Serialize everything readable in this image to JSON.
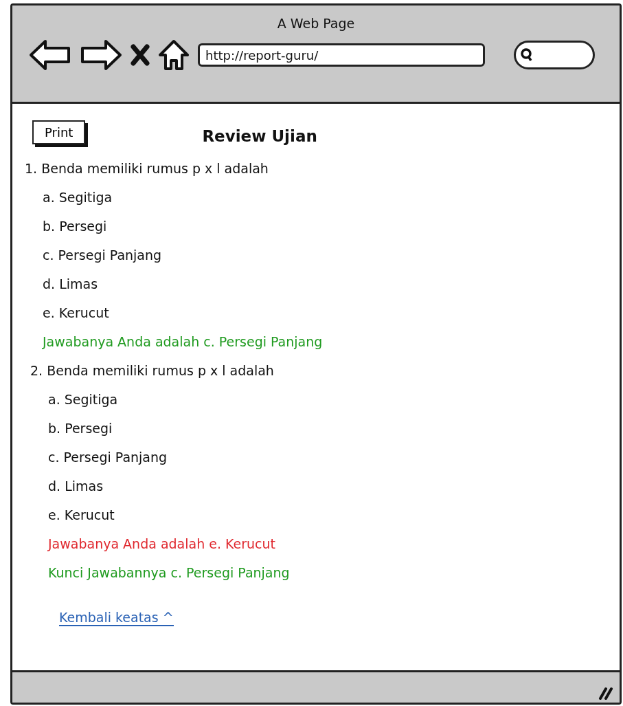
{
  "window": {
    "title": "A Web Page"
  },
  "toolbar": {
    "url": "http://report-guru/"
  },
  "content": {
    "print_button": "Print",
    "heading": "Review Ujian",
    "questions": [
      {
        "text": "1. Benda memiliki rumus p x l adalah",
        "options": [
          "a. Segitiga",
          "b. Persegi",
          "c. Persegi Panjang",
          "d. Limas",
          "e. Kerucut"
        ],
        "feedback": [
          {
            "text": "Jawabanya Anda adalah c. Persegi Panjang",
            "color": "#1e9a1e"
          }
        ]
      },
      {
        "text": "2. Benda memiliki rumus p x l adalah",
        "options": [
          "a. Segitiga",
          "b. Persegi",
          "c. Persegi Panjang",
          "d. Limas",
          "e. Kerucut"
        ],
        "feedback": [
          {
            "text": "Jawabanya Anda adalah e. Kerucut",
            "color": "#e0282e"
          },
          {
            "text": "Kunci Jawabannya c. Persegi Panjang",
            "color": "#1e9a1e"
          }
        ]
      }
    ],
    "back_link": "Kembali keatas ^"
  }
}
